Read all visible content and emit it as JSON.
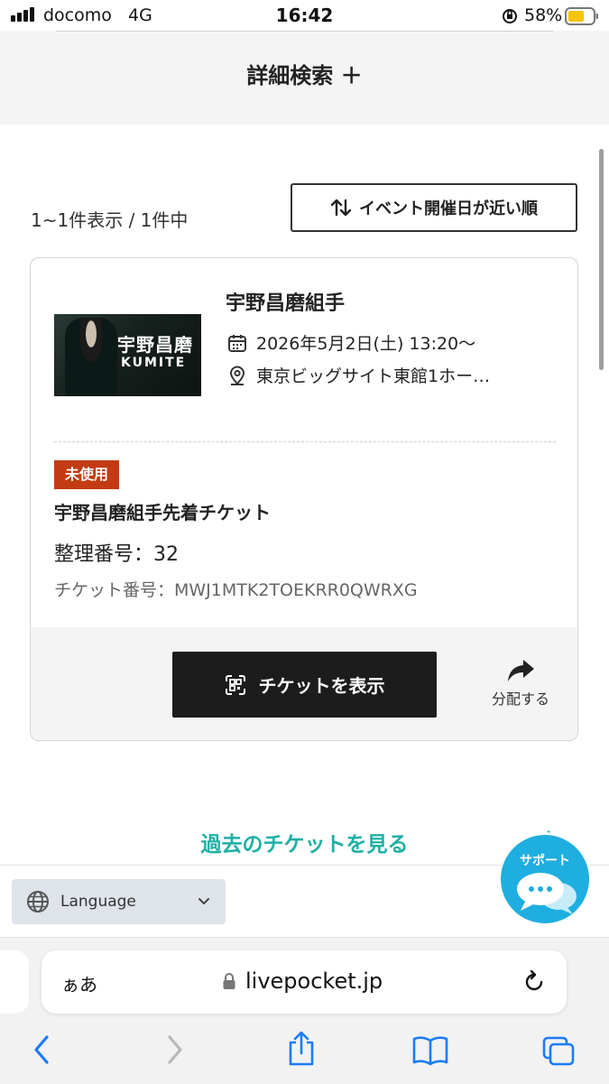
{
  "status_bar": {
    "carrier": "docomo",
    "network": "4G",
    "time": "16:42",
    "battery": "58%"
  },
  "search": {
    "detail_label": "詳細検索 ＋"
  },
  "results": {
    "count_text": "1~1件表示 / 1件中",
    "sort_label": "イベント開催日が近い順"
  },
  "card": {
    "thumbnail": {
      "title": "宇野昌磨",
      "subtitle": "KUMITE"
    },
    "event_title": "宇野昌磨組手",
    "date": "2026年5月2日(土) 13:20〜",
    "venue": "東京ビッグサイト東館1ホー…",
    "status_badge": "未使用",
    "ticket_name": "宇野昌磨組手先着チケット",
    "seq_number": "整理番号：32",
    "ticket_number": "チケット番号：MWJ1MTK2TOEKRR0QWRXG",
    "show_ticket_label": "チケットを表示",
    "share_label": "分配する"
  },
  "past_tickets_link": "過去のチケットを見る",
  "language": {
    "label": "Language"
  },
  "support": {
    "label": "サポート"
  },
  "safari": {
    "aa_label": "ぁあ",
    "url": "livepocket.jp"
  },
  "colors": {
    "accent": "#1fb0a4",
    "badge": "#c33b12",
    "support": "#1faee0",
    "button": "#1c1c1c"
  }
}
